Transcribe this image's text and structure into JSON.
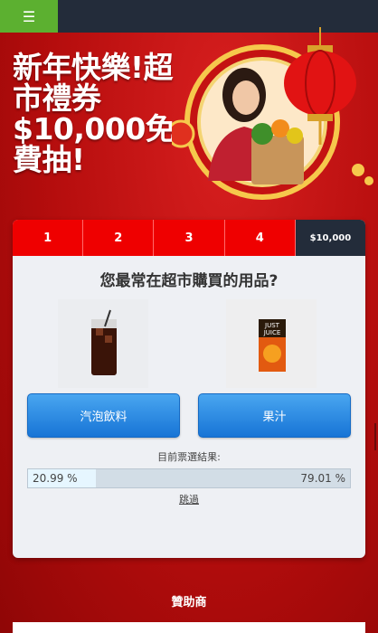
{
  "topbar": {
    "menu_icon": "☰"
  },
  "hero": {
    "title": "新年快樂!超市禮券$10,000免費抽!"
  },
  "steps": [
    "1",
    "2",
    "3",
    "4",
    "$10,000"
  ],
  "question": "您最常在超市購買的用品?",
  "products": [
    {
      "name": "cola-image",
      "icon": "soda-glass"
    },
    {
      "name": "juice-image",
      "icon": "juice-carton",
      "label_1": "JUST",
      "label_2": "JUICE"
    }
  ],
  "choices": [
    "汽泡飲料",
    "果汁"
  ],
  "results": {
    "label": "目前票選結果:",
    "left_pct_text": "20.99 %",
    "right_pct_text": "79.01 %",
    "left_fraction": 0.2099
  },
  "skip_label": "跳過",
  "sponsor_label": "贊助商",
  "colors": {
    "accent": "#ef0000",
    "nav": "#232c3a",
    "menu": "#5cb030",
    "button": "#1774d6"
  }
}
